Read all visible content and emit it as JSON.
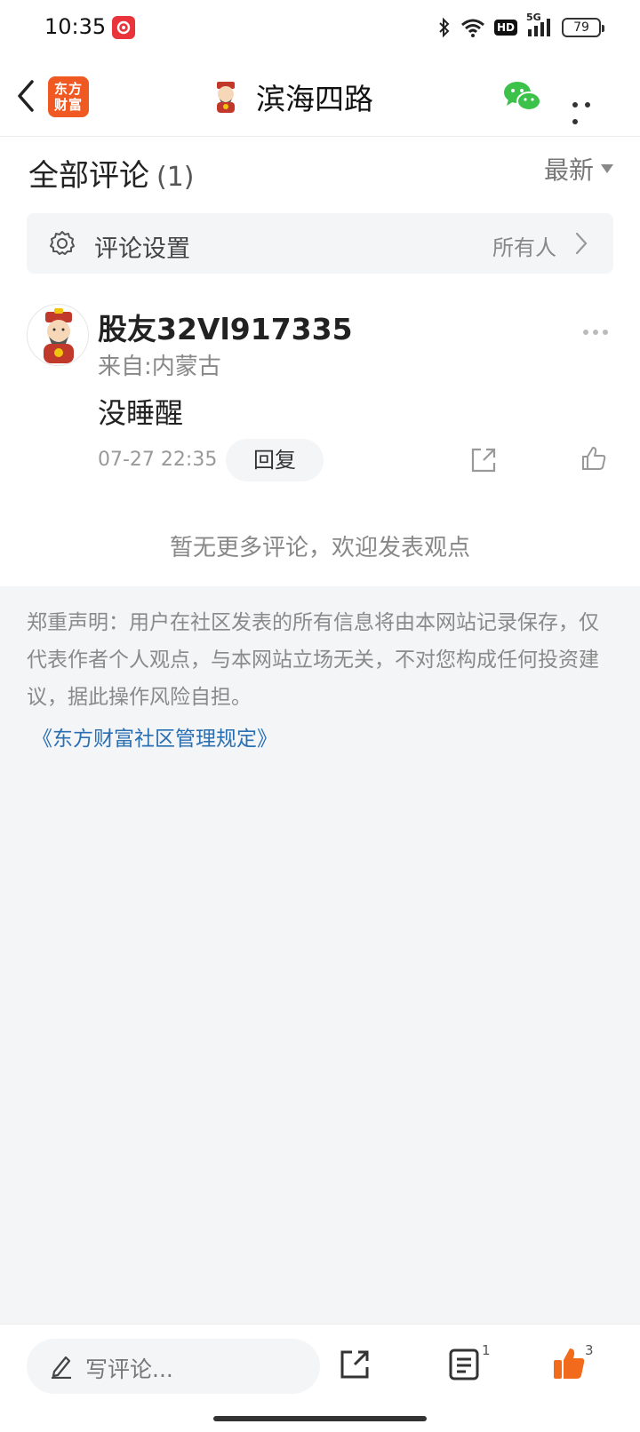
{
  "status_bar": {
    "time": "10:35",
    "network": "5G",
    "hd": "HD",
    "battery": "79"
  },
  "nav": {
    "logo_line1": "东方",
    "logo_line2": "财富",
    "title": "滨海四路"
  },
  "comments_header": {
    "title": "全部评论",
    "count": "(1)",
    "sort": "最新"
  },
  "settings": {
    "label": "评论设置",
    "value": "所有人"
  },
  "comment": {
    "user": "股友32Vl917335",
    "location": "来自:内蒙古",
    "text": "没睡醒",
    "time": "07-27 22:35",
    "reply": "回复"
  },
  "no_more": "暂无更多评论，欢迎发表观点",
  "disclaimer": "郑重声明：用户在社区发表的所有信息将由本网站记录保存，仅代表作者个人观点，与本网站立场无关，不对您构成任何投资建议，据此操作风险自担。",
  "rules_link": "《东方财富社区管理规定》",
  "bottom_bar": {
    "placeholder": "写评论...",
    "comment_count": "1",
    "like_count": "3"
  },
  "colors": {
    "brand_orange": "#f05a22",
    "like_orange": "#f26a1b",
    "wechat_green": "#3cc24a",
    "link_blue": "#2b6fb3"
  }
}
